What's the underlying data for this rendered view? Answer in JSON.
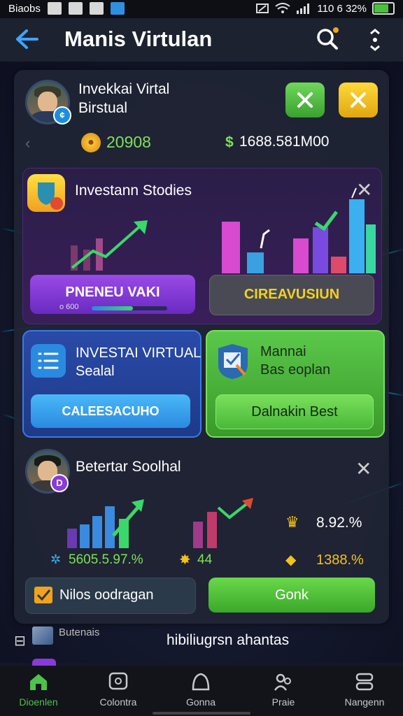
{
  "status_bar": {
    "carrier": "Biaobs",
    "right_text": "110 6 32%"
  },
  "header": {
    "title": "Manis Virtulan"
  },
  "profile": {
    "name_line1": "Invekkai Virtal",
    "name_line2": "Birstual",
    "badge": "¢",
    "coins": "20908",
    "balance_symbol": "$",
    "balance": "1688.581M00"
  },
  "studies": {
    "title": "Investann Stodies",
    "primary_button": "PNENEU VAKI",
    "progress_label": "o 600",
    "progress": 0.55,
    "secondary_button": "CIREAVUSIUN"
  },
  "virtual_tile": {
    "title_line1": "INVESTAI VIRTUAL",
    "title_line2": "Sealal",
    "button": "CALEESACUHO"
  },
  "manual_tile": {
    "title_line1": "Mannai",
    "title_line2": "Bas eoplan",
    "button": "Dalnakin Best"
  },
  "social": {
    "title": "Betertar Soolhal",
    "badge": "D",
    "stat1": "5605.5.97.%",
    "stat2": "44",
    "stat3": "8.92.%",
    "stat4": "1388.%",
    "left_button": "Nilos oodragan",
    "right_button": "Gonk"
  },
  "footer_strip": {
    "left_label": "Butenais",
    "center_text": "hibiliugrsn ahantas"
  },
  "bottom_nav": {
    "items": [
      {
        "label": "Dioenlen",
        "icon": "home-icon"
      },
      {
        "label": "Colontra",
        "icon": "chat-icon"
      },
      {
        "label": "Gonna",
        "icon": "shield-icon"
      },
      {
        "label": "Praie",
        "icon": "people-icon"
      },
      {
        "label": "Nangenn",
        "icon": "menu-icon"
      }
    ]
  },
  "colors": {
    "accent_green": "#4ec24a",
    "accent_blue": "#3fa4ff",
    "purple": "#7b3ad8",
    "yellow": "#f2c21d"
  }
}
